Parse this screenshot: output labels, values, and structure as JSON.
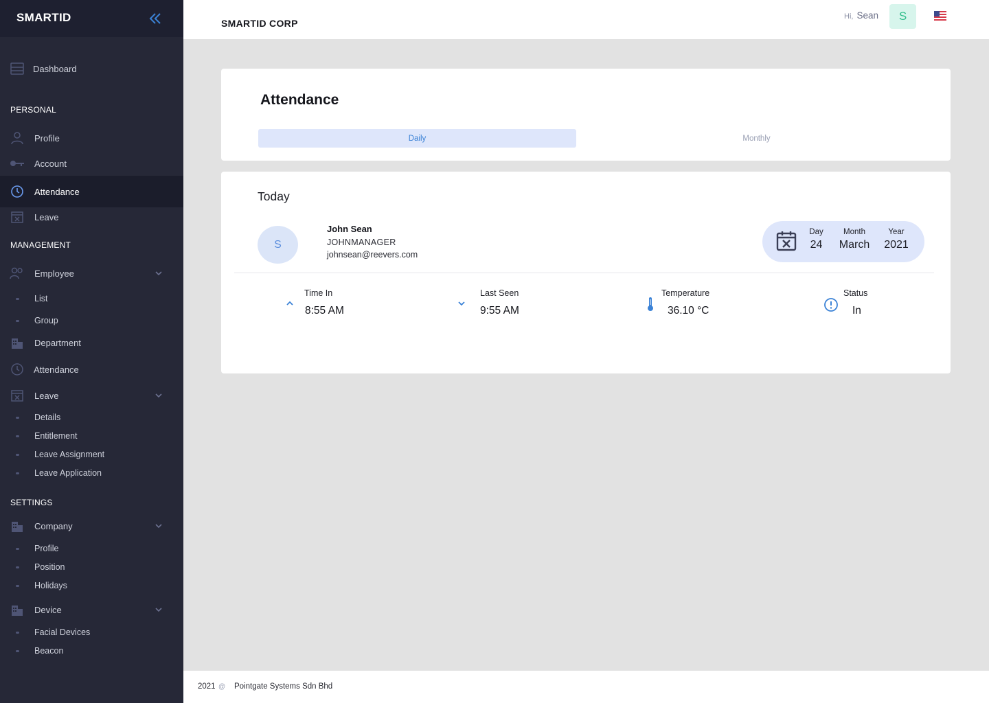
{
  "sidebar": {
    "logo": "SMARTID",
    "items": {
      "dashboard": "Dashboard",
      "personal_section": "PERSONAL",
      "profile": "Profile",
      "account": "Account",
      "attendance": "Attendance",
      "leave": "Leave",
      "management_section": "MANAGEMENT",
      "employee": "Employee",
      "employee_list": "List",
      "employee_group": "Group",
      "department": "Department",
      "mgmt_attendance": "Attendance",
      "mgmt_leave": "Leave",
      "leave_details": "Details",
      "leave_entitlement": "Entitlement",
      "leave_assignment": "Leave Assignment",
      "leave_application": "Leave Application",
      "settings_section": "SETTINGS",
      "company": "Company",
      "company_profile": "Profile",
      "company_position": "Position",
      "company_holidays": "Holidays",
      "device": "Device",
      "facial_devices": "Facial Devices",
      "beacon": "Beacon"
    }
  },
  "header": {
    "company": "SMARTID CORP",
    "greeting": "Hi,",
    "user_name": "Sean",
    "avatar_initial": "S"
  },
  "attendance": {
    "title": "Attendance",
    "tabs": {
      "daily": "Daily",
      "monthly": "Monthly"
    },
    "today_label": "Today",
    "employee": {
      "initial": "S",
      "name": "John Sean",
      "role": "JOHNMANAGER",
      "email": "johnsean@reevers.com"
    },
    "date": {
      "day_label": "Day",
      "day": "24",
      "month_label": "Month",
      "month": "March",
      "year_label": "Year",
      "year": "2021"
    },
    "stats": {
      "time_in_label": "Time In",
      "time_in": "8:55 AM",
      "last_seen_label": "Last Seen",
      "last_seen": "9:55 AM",
      "temperature_label": "Temperature",
      "temperature": "36.10 °C",
      "status_label": "Status",
      "status": "In"
    }
  },
  "footer": {
    "year": "2021",
    "symbol": "@",
    "company": "Pointgate Systems Sdn Bhd"
  },
  "colors": {
    "sidebar_bg": "#262837",
    "sidebar_top": "#1e2030",
    "accent_blue": "#3b82d6",
    "pill_bg": "#dee6fb",
    "avatar_green": "#2fbd8a"
  }
}
